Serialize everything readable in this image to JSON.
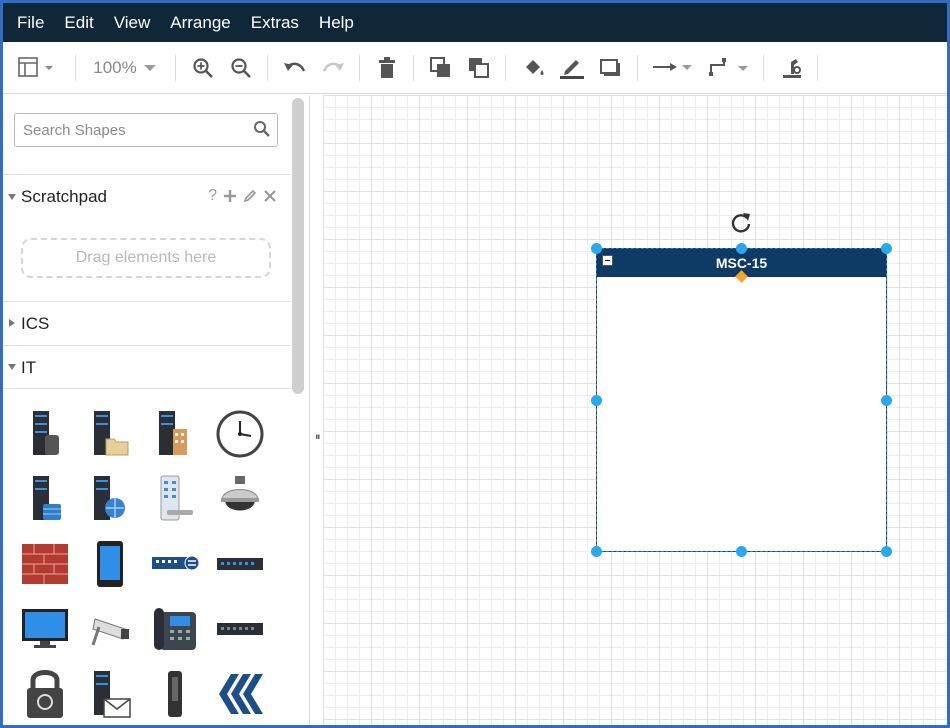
{
  "menu": [
    "File",
    "Edit",
    "View",
    "Arrange",
    "Extras",
    "Help"
  ],
  "toolbar": {
    "zoom": "100%",
    "icons": [
      "layout-icon",
      "zoom-in-icon",
      "zoom-out-icon",
      "undo-icon",
      "redo-icon",
      "delete-icon",
      "to-front-icon",
      "to-back-icon",
      "fill-color-icon",
      "line-color-icon",
      "shadow-icon",
      "connection-icon",
      "waypoints-icon",
      "format-icon"
    ]
  },
  "sidebar": {
    "search_placeholder": "Search Shapes",
    "scratchpad": {
      "title": "Scratchpad",
      "help": "?",
      "drag_hint": "Drag elements here"
    },
    "sections": [
      "ICS",
      "IT"
    ]
  },
  "canvas": {
    "container_label": "MSC-15"
  }
}
